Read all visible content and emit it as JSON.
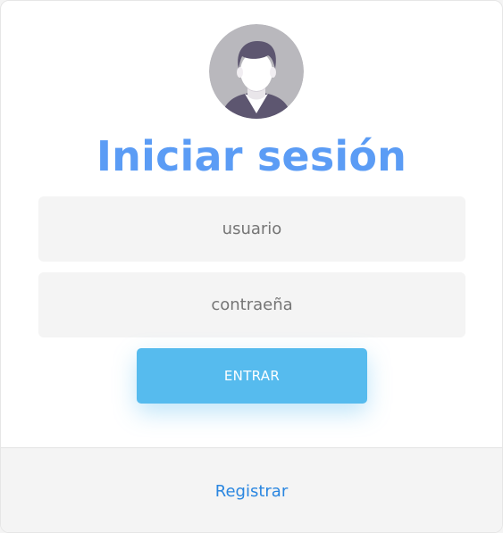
{
  "login": {
    "title": "Iniciar sesión",
    "username_placeholder": "usuario",
    "password_placeholder": "contraeña",
    "submit_label": "ENTRAR",
    "register_link": "Registrar",
    "avatar_icon": "user-avatar-icon"
  },
  "colors": {
    "title": "#5b9cf5",
    "button": "#56bbee",
    "link": "#2a86e0",
    "field_bg": "#f4f4f4",
    "footer_bg": "#f4f4f4"
  }
}
